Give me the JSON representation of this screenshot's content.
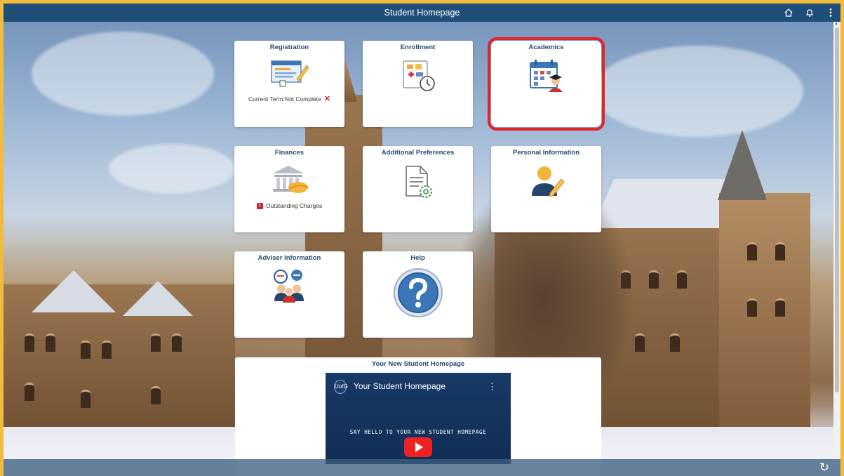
{
  "header": {
    "title": "Student Homepage"
  },
  "header_icons": [
    "home-icon",
    "bell-icon",
    "kebab-menu-icon"
  ],
  "tiles": [
    {
      "title": "Registration",
      "status": "Current Term:Not Complete",
      "status_icon": "x-icon"
    },
    {
      "title": "Enrollment"
    },
    {
      "title": "Academics"
    },
    {
      "title": "Finances",
      "status": "Outstanding Charges",
      "status_icon": "alert-icon"
    },
    {
      "title": "Additional Preferences"
    },
    {
      "title": "Personal Information"
    },
    {
      "title": "Adviser Information"
    },
    {
      "title": "Help"
    }
  ],
  "video_tile": {
    "title": "Your New Student Homepage",
    "video_name": "Your Student Homepage",
    "logo_text": "UofG",
    "subtitle": "SAY HELLO TO YOUR NEW STUDENT HOMEPAGE"
  },
  "colors": {
    "header": "#1f4e79",
    "tile_title": "#274a6e",
    "selected_outline": "#e0252c",
    "border": "#f3bb3c"
  }
}
